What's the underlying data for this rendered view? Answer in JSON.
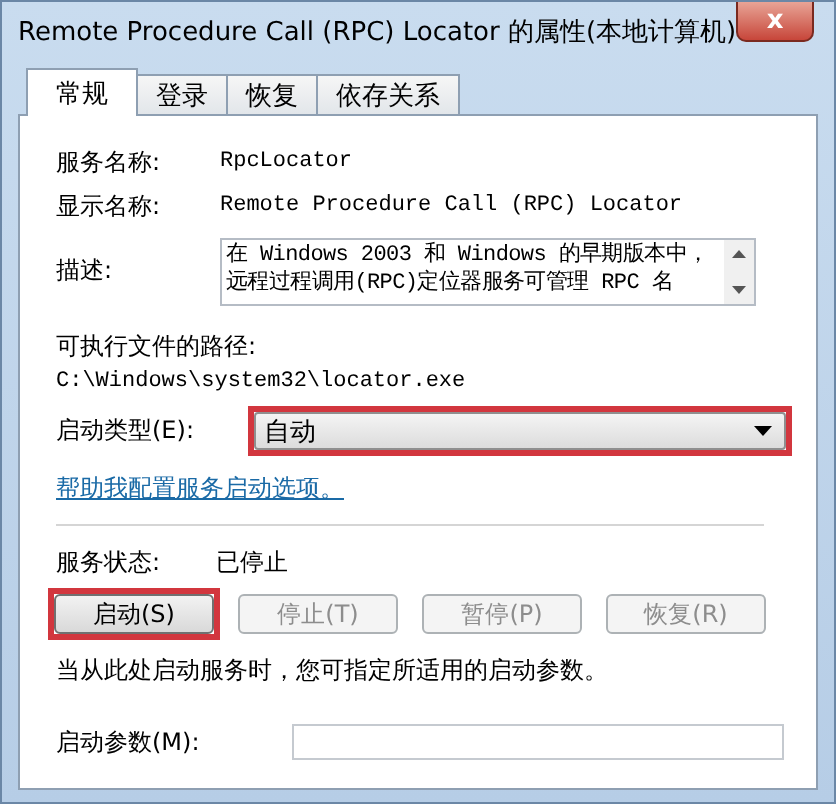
{
  "window": {
    "title": "Remote Procedure Call (RPC) Locator 的属性(本地计算机)",
    "close": "x"
  },
  "tabs": [
    {
      "label": "常规",
      "selected": true
    },
    {
      "label": "登录",
      "selected": false
    },
    {
      "label": "恢复",
      "selected": false
    },
    {
      "label": "依存关系",
      "selected": false
    }
  ],
  "fields": [
    {
      "label": "服务名称:",
      "value": "RpcLocator"
    },
    {
      "label": "显示名称:",
      "value": "Remote Procedure Call (RPC) Locator"
    }
  ],
  "description": {
    "label": "描述:",
    "lines": [
      "在 Windows 2003 和 Windows 的早期版本中，",
      "远程过程调用(RPC)定位器服务可管理 RPC 名"
    ]
  },
  "path": {
    "label": "可执行文件的路径:",
    "value": "C:\\Windows\\system32\\locator.exe"
  },
  "startup_type": {
    "label": "启动类型(E):",
    "value": "自动",
    "highlighted": true
  },
  "help_link": "帮助我配置服务启动选项。",
  "service_status": {
    "label": "服务状态:",
    "value": "已停止"
  },
  "buttons": [
    {
      "label": "启动(S)",
      "disabled": false,
      "highlighted": true
    },
    {
      "label": "停止(T)",
      "disabled": true,
      "highlighted": false
    },
    {
      "label": "暂停(P)",
      "disabled": true,
      "highlighted": false
    },
    {
      "label": "恢复(R)",
      "disabled": true,
      "highlighted": false
    }
  ],
  "note": "当从此处启动服务时，您可指定所适用的启动参数。",
  "start_params": {
    "label": "启动参数(M):"
  }
}
